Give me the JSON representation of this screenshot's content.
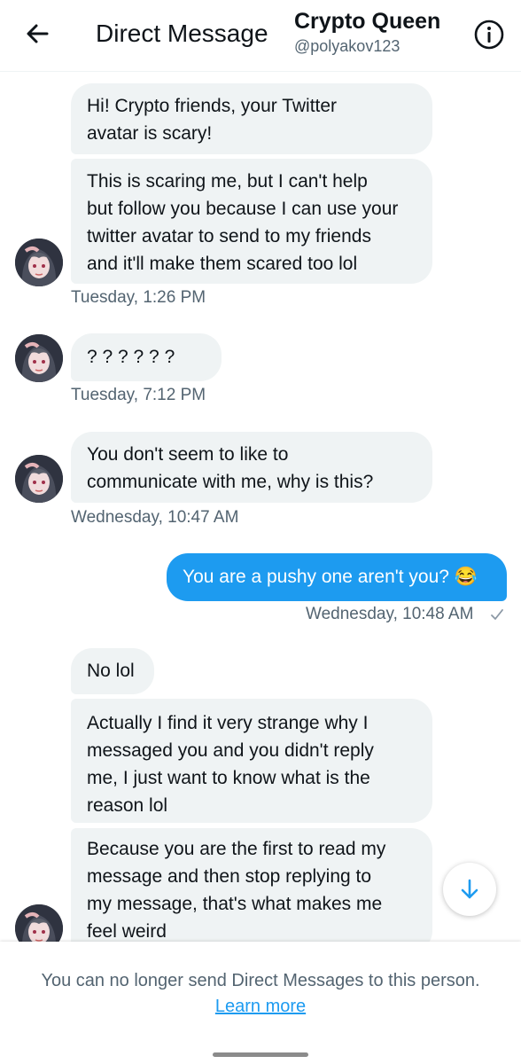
{
  "header": {
    "title": "Direct Message",
    "contact_name": "Crypto Queen",
    "contact_handle": "@polyakov123"
  },
  "messages": [
    {
      "text": "Hi! Crypto friends, your Twitter\navatar is scary!",
      "direction": "in"
    },
    {
      "text": "This is scaring me, but I can't help\nbut follow you because I can use your\ntwitter avatar to send to my friends\nand it'll make them scared too lol",
      "direction": "in"
    },
    {
      "text": "? ? ? ? ? ?",
      "direction": "in"
    },
    {
      "text": "You don't seem to like to\ncommunicate with me, why is this?",
      "direction": "in"
    },
    {
      "text": "You are a pushy one aren't you? 😂",
      "direction": "out"
    },
    {
      "text": "No lol",
      "direction": "in"
    },
    {
      "text": "Actually I find it very strange why I\nmessaged you and you didn't reply\nme, I just want to know what is the\nreason lol",
      "direction": "in"
    },
    {
      "text": "Because you are the first to read my\nmessage and then stop replying to\nmy message, that's what makes me\nfeel weird",
      "direction": "in"
    }
  ],
  "timestamps": [
    "Tuesday, 1:26 PM",
    "Tuesday, 7:12 PM",
    "Wednesday, 10:47 AM",
    "Wednesday, 10:48 AM"
  ],
  "footer": {
    "notice": "You can no longer send Direct Messages to this person.",
    "link": "Learn more"
  },
  "icons": {
    "back": "arrow-left-icon",
    "info": "info-icon",
    "sent": "check-icon",
    "scroll": "arrow-down-icon"
  },
  "colors": {
    "accent": "#1d9bf0",
    "incoming_bubble": "#eff3f4",
    "secondary_text": "#536471"
  }
}
